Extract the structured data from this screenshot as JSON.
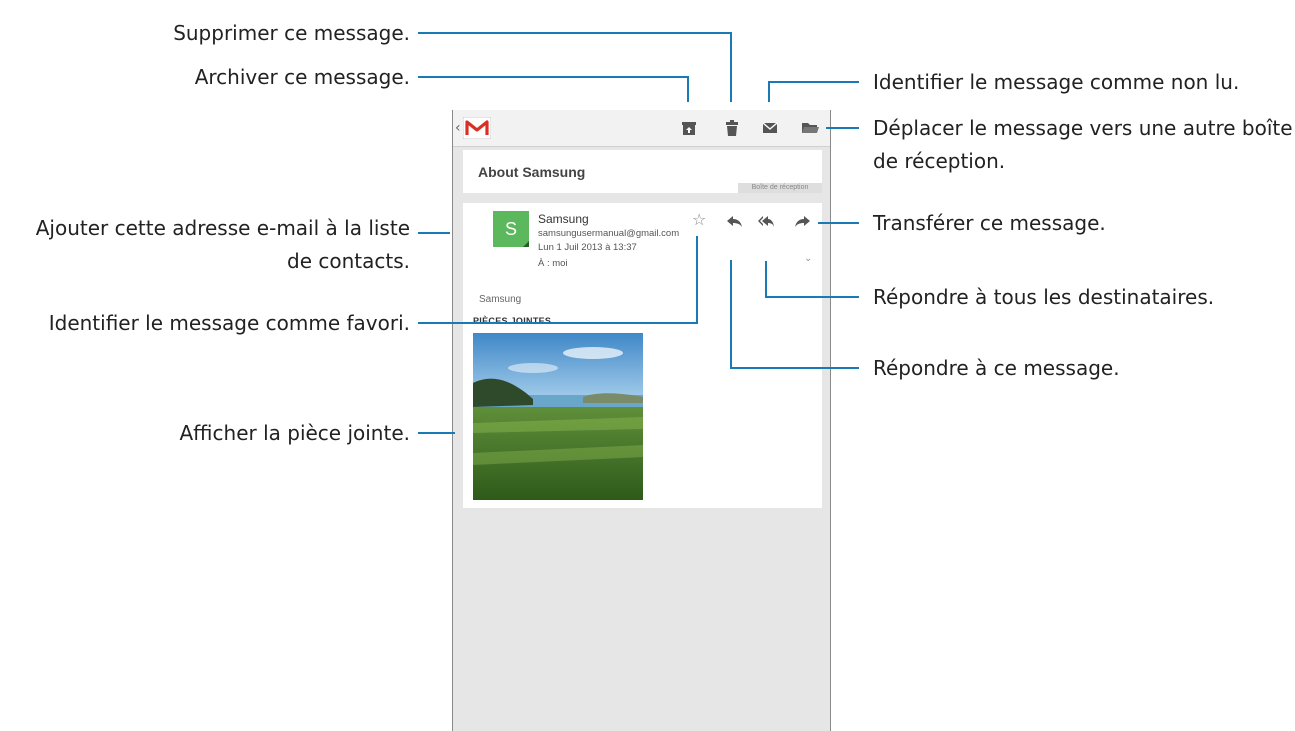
{
  "callouts": {
    "delete": "Supprimer ce message.",
    "archive": "Archiver ce message.",
    "mark_unread": "Identifier le message comme non lu.",
    "move": "Déplacer le message vers une autre boîte de réception.",
    "add_contact": "Ajouter cette adresse e-mail à la liste de contacts.",
    "forward": "Transférer ce message.",
    "reply_all": "Répondre à tous les destinataires.",
    "favorite": "Identifier le message comme favori.",
    "reply": "Répondre à ce message.",
    "view_attachment": "Afficher la pièce jointe."
  },
  "email": {
    "subject": "About Samsung",
    "label": "Boîte de réception",
    "avatar_letter": "S",
    "sender_name": "Samsung",
    "sender_email": "samsungusermanual@gmail.com",
    "date": "Lun 1 Juil 2013 à 13:37",
    "to": "À : moi",
    "body_snippet": "Samsung",
    "attachments_heading": "PIÈCES JOINTES"
  },
  "colors": {
    "accent": "#1a7ab5",
    "avatar": "#5cb85c",
    "gmail_red": "#d93025"
  },
  "icons": {
    "back": "chevron-left-icon",
    "app": "gmail-icon",
    "archive": "archive-icon",
    "delete": "trash-icon",
    "unread": "envelope-icon",
    "move": "folder-icon",
    "star": "star-icon",
    "reply": "reply-icon",
    "reply_all": "reply-all-icon",
    "forward": "forward-icon",
    "expand": "chevron-down-icon"
  }
}
